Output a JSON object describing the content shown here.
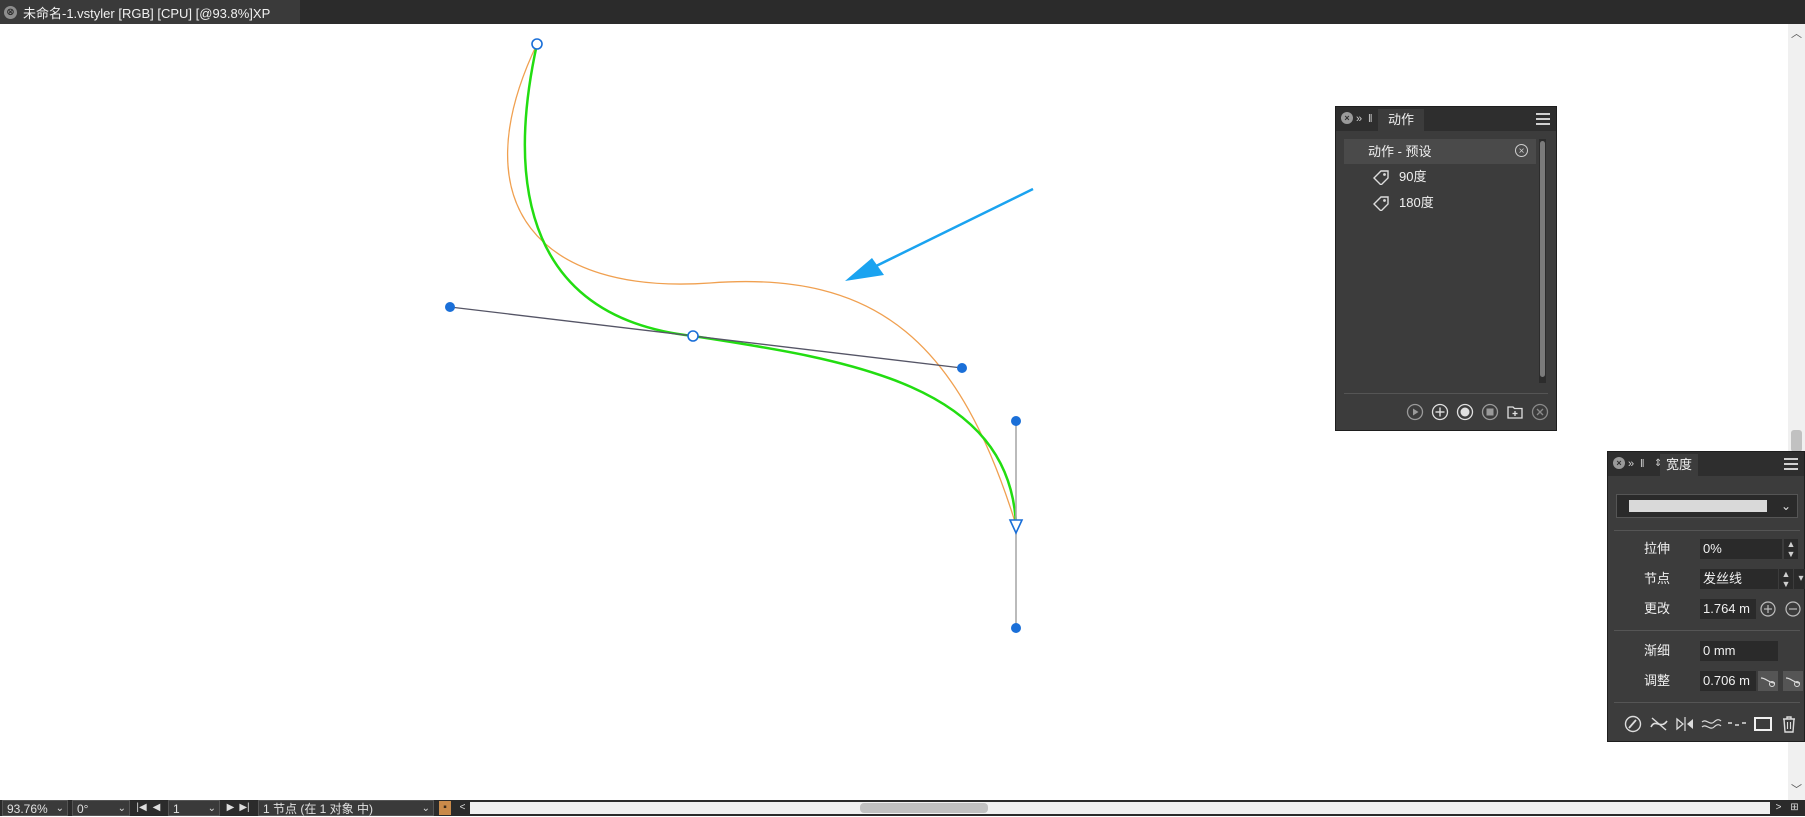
{
  "document": {
    "tab_title": "未命名-1.vstyler [RGB] [CPU] [@93.8%]XP",
    "close_glyph": "⊗"
  },
  "colors": {
    "green_curve": "#22dd11",
    "orange_curve": "#f0a050",
    "node_blue": "#1a6fd8",
    "arrow_blue": "#1aa3f0",
    "panel_bg": "#3c3c3c"
  },
  "actions_panel": {
    "tab_label": "动作",
    "group_label": "动作 - 预设",
    "items": [
      {
        "label": "90度",
        "icon": "tag-icon"
      },
      {
        "label": "180度",
        "icon": "tag-icon"
      }
    ],
    "footer_buttons": [
      "play-icon",
      "add-icon",
      "record-icon",
      "stop-icon",
      "new-folder-icon",
      "delete-icon"
    ]
  },
  "width_panel": {
    "tab_label": "宽度",
    "rows": {
      "stretch": {
        "label": "拉伸",
        "value": "0%"
      },
      "node": {
        "label": "节点",
        "value": "发丝线"
      },
      "change": {
        "label": "更改",
        "value": "1.764 m"
      },
      "taper": {
        "label": "渐细",
        "value": "0 mm"
      },
      "adjust": {
        "label": "调整",
        "value": "0.706 m"
      }
    },
    "tools": [
      "pressure-icon",
      "no-pressure-icon",
      "mirror-icon",
      "wave-icon",
      "dash-icon",
      "rectangle-icon",
      "trash-icon"
    ]
  },
  "statusbar": {
    "zoom": "93.76%",
    "angle": "0°",
    "page": "1",
    "selection": "1 节点 (在 1 对象 中)"
  }
}
